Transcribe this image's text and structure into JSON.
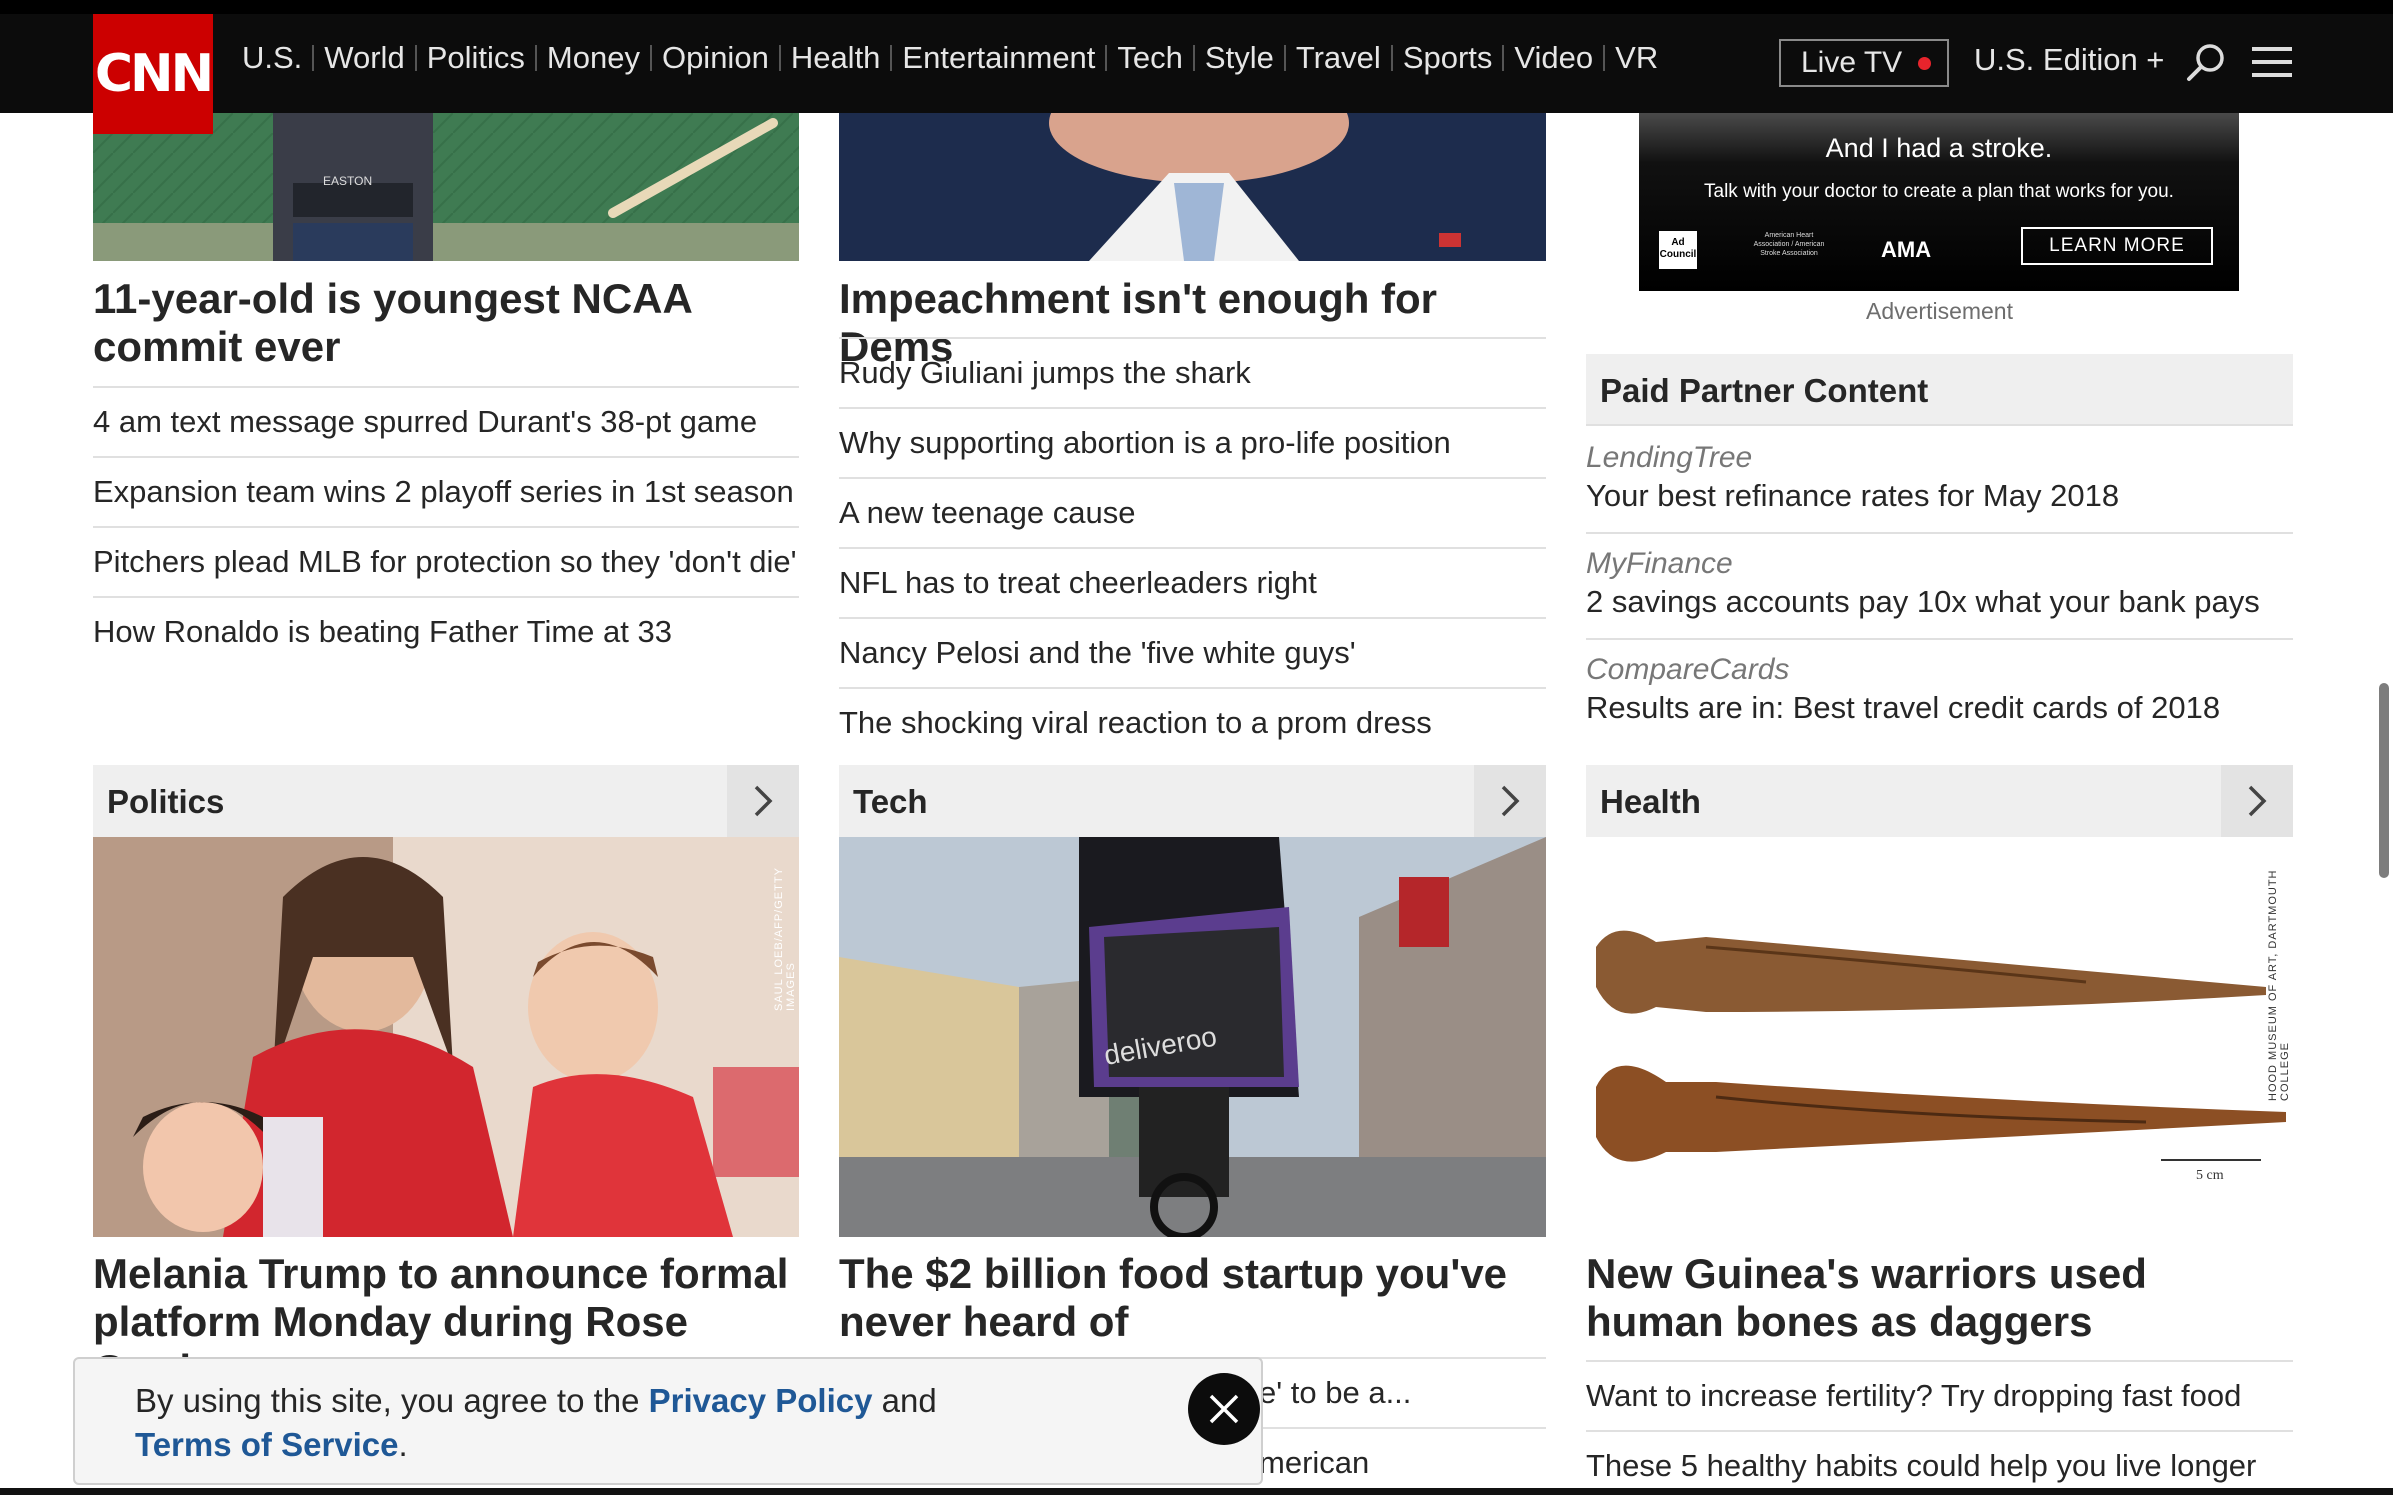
{
  "header": {
    "logo_text": "CNN",
    "nav_items": [
      "U.S.",
      "World",
      "Politics",
      "Money",
      "Opinion",
      "Health",
      "Entertainment",
      "Tech",
      "Style",
      "Travel",
      "Sports",
      "Video",
      "VR"
    ],
    "live_tv": "Live TV",
    "edition": "U.S. Edition +",
    "search_icon": "search-icon",
    "menu_icon": "hamburger-menu-icon"
  },
  "sports": {
    "headline": "11-year-old is youngest NCAA commit ever",
    "items": [
      "4 am text message spurred Durant's 38-pt game",
      "Expansion team wins 2 playoff series in 1st season",
      "Pitchers plead MLB for protection so they 'don't die'",
      "How Ronaldo is beating Father Time at 33"
    ]
  },
  "opinion": {
    "headline": "Impeachment isn't enough for Dems",
    "items": [
      "Rudy Giuliani jumps the shark",
      "Why supporting abortion is a pro-life position",
      "A new teenage cause",
      "NFL has to treat cheerleaders right",
      "Nancy Pelosi and the 'five white guys'",
      "The shocking viral reaction to a prom dress"
    ]
  },
  "ad": {
    "line1": "And I had a stroke.",
    "line2": "Talk with your doctor to create a plan that works for you.",
    "logo1": "Ad Council",
    "logo2": "American Heart Association / American Stroke Association",
    "logo3": "AMA",
    "button": "LEARN MORE",
    "label": "Advertisement"
  },
  "paid_partner": {
    "title": "Paid Partner Content",
    "items": [
      {
        "source": "LendingTree",
        "text": "Your best refinance rates for May 2018"
      },
      {
        "source": "MyFinance",
        "text": "2 savings accounts pay 10x what your bank pays"
      },
      {
        "source": "CompareCards",
        "text": "Results are in: Best travel credit cards of 2018"
      }
    ]
  },
  "politics": {
    "section": "Politics",
    "credit": "SAUL LOEB/AFP/GETTY IMAGES",
    "headline": "Melania Trump to announce formal platform Monday during Rose Garden"
  },
  "tech": {
    "section": "Tech",
    "bag_text": "deliveroo",
    "headline": "The $2 billion food startup you've never heard of",
    "items_partial": [
      "e' to be a...",
      "merican"
    ]
  },
  "health": {
    "section": "Health",
    "credit": "HOOD MUSEUM OF ART, DARTMOUTH COLLEGE",
    "scale": "5 cm",
    "headline": "New Guinea's warriors used human bones as daggers",
    "items": [
      "Want to increase fertility? Try dropping fast food",
      "These 5 healthy habits could help you live longer"
    ]
  },
  "cookie": {
    "prefix": "By using this site, you agree to the ",
    "privacy": "Privacy Policy",
    "middle": " and ",
    "terms": "Terms of Service",
    "suffix": "."
  },
  "colors": {
    "brand_red": "#cc0000",
    "link_blue": "#1f5896",
    "header_bg": "#0c0c0c"
  }
}
